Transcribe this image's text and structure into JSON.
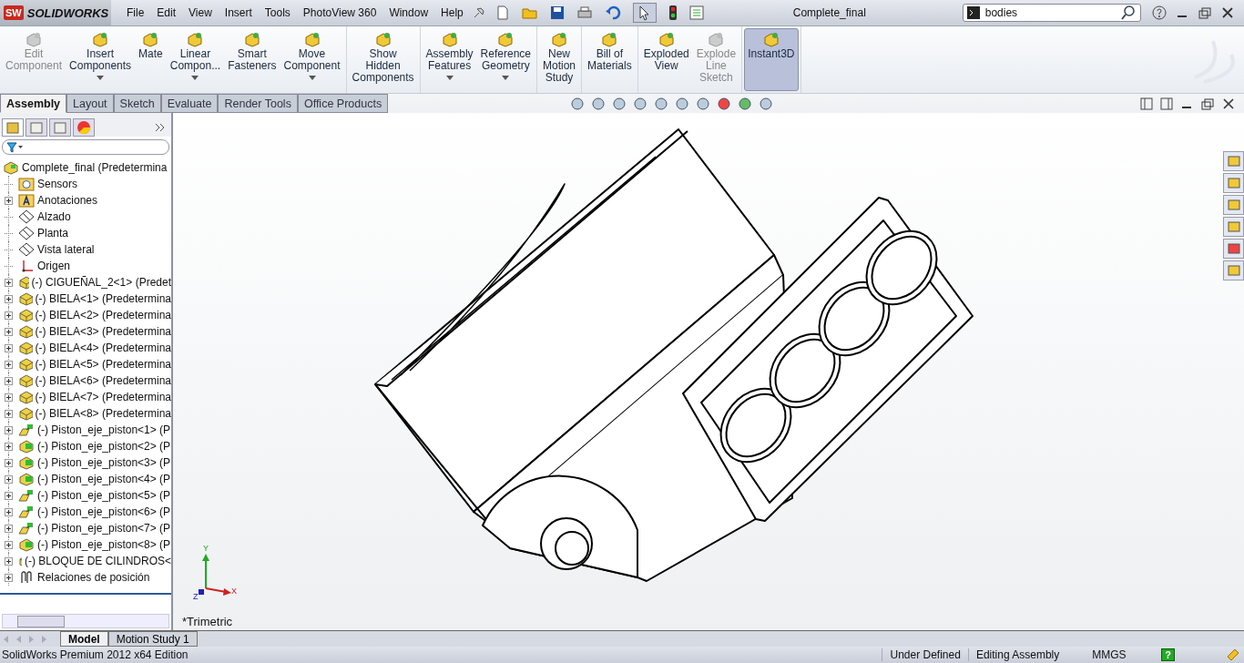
{
  "logo": {
    "badge": "SW",
    "name": "SOLIDWORKS"
  },
  "menu": [
    "File",
    "Edit",
    "View",
    "Insert",
    "Tools",
    "PhotoView 360",
    "Window",
    "Help"
  ],
  "document_title": "Complete_final",
  "search": {
    "value": "bodies"
  },
  "command_groups": [
    [
      {
        "label": "Edit\nComponent",
        "disabled": true,
        "dropdown": false,
        "selected": false
      },
      {
        "label": "Insert\nComponents",
        "disabled": false,
        "dropdown": true,
        "selected": false
      },
      {
        "label": "Mate",
        "disabled": false,
        "dropdown": false,
        "selected": false
      },
      {
        "label": "Linear\nCompon...",
        "disabled": false,
        "dropdown": true,
        "selected": false
      },
      {
        "label": "Smart\nFasteners",
        "disabled": false,
        "dropdown": false,
        "selected": false
      },
      {
        "label": "Move\nComponent",
        "disabled": false,
        "dropdown": true,
        "selected": false
      }
    ],
    [
      {
        "label": "Show\nHidden\nComponents",
        "disabled": false,
        "dropdown": false,
        "selected": false
      }
    ],
    [
      {
        "label": "Assembly\nFeatures",
        "disabled": false,
        "dropdown": true,
        "selected": false
      },
      {
        "label": "Reference\nGeometry",
        "disabled": false,
        "dropdown": true,
        "selected": false
      }
    ],
    [
      {
        "label": "New\nMotion\nStudy",
        "disabled": false,
        "dropdown": false,
        "selected": false
      }
    ],
    [
      {
        "label": "Bill of\nMaterials",
        "disabled": false,
        "dropdown": false,
        "selected": false
      }
    ],
    [
      {
        "label": "Exploded\nView",
        "disabled": false,
        "dropdown": false,
        "selected": false
      },
      {
        "label": "Explode\nLine\nSketch",
        "disabled": true,
        "dropdown": false,
        "selected": false
      }
    ],
    [
      {
        "label": "Instant3D",
        "disabled": false,
        "dropdown": false,
        "selected": true
      }
    ]
  ],
  "tabs": [
    {
      "label": "Assembly",
      "selected": true
    },
    {
      "label": "Layout",
      "selected": false
    },
    {
      "label": "Sketch",
      "selected": false
    },
    {
      "label": "Evaluate",
      "selected": false
    },
    {
      "label": "Render Tools",
      "selected": false
    },
    {
      "label": "Office Products",
      "selected": false
    }
  ],
  "panel_tabs": [
    {
      "selected": true
    },
    {
      "selected": false
    },
    {
      "selected": false
    },
    {
      "selected": false
    }
  ],
  "tree": {
    "label": "Complete_final  (Predetermina",
    "kind": "assembly",
    "children": [
      {
        "label": "Sensors",
        "kind": "sensor",
        "expandable": false
      },
      {
        "label": "Anotaciones",
        "kind": "annotation",
        "expandable": true
      },
      {
        "label": "Alzado",
        "kind": "plane",
        "expandable": false
      },
      {
        "label": "Planta",
        "kind": "plane",
        "expandable": false
      },
      {
        "label": "Vista lateral",
        "kind": "plane",
        "expandable": false
      },
      {
        "label": "Origen",
        "kind": "origin",
        "expandable": false
      },
      {
        "label": "(-) CIGUEÑAL_2<1> (Predet",
        "kind": "part",
        "expandable": true
      },
      {
        "label": "(-) BIELA<1> (Predetermina",
        "kind": "part",
        "expandable": true
      },
      {
        "label": "(-) BIELA<2> (Predetermina",
        "kind": "part",
        "expandable": true
      },
      {
        "label": "(-) BIELA<3> (Predetermina",
        "kind": "part",
        "expandable": true
      },
      {
        "label": "(-) BIELA<4> (Predetermina",
        "kind": "part",
        "expandable": true
      },
      {
        "label": "(-) BIELA<5> (Predetermina",
        "kind": "part",
        "expandable": true
      },
      {
        "label": "(-) BIELA<6> (Predetermina",
        "kind": "part",
        "expandable": true
      },
      {
        "label": "(-) BIELA<7> (Predetermina",
        "kind": "part",
        "expandable": true
      },
      {
        "label": "(-) BIELA<8> (Predetermina",
        "kind": "part",
        "expandable": true
      },
      {
        "label": "(-) Piston_eje_piston<1> (P",
        "kind": "flexible",
        "expandable": true
      },
      {
        "label": "(-) Piston_eje_piston<2> (P",
        "kind": "subassembly",
        "expandable": true
      },
      {
        "label": "(-) Piston_eje_piston<3> (P",
        "kind": "subassembly",
        "expandable": true
      },
      {
        "label": "(-) Piston_eje_piston<4> (P",
        "kind": "subassembly",
        "expandable": true
      },
      {
        "label": "(-) Piston_eje_piston<5> (P",
        "kind": "flexible",
        "expandable": true
      },
      {
        "label": "(-) Piston_eje_piston<6> (P",
        "kind": "flexible",
        "expandable": true
      },
      {
        "label": "(-) Piston_eje_piston<7> (P",
        "kind": "flexible",
        "expandable": true
      },
      {
        "label": "(-) Piston_eje_piston<8> (P",
        "kind": "subassembly",
        "expandable": true
      },
      {
        "label": "(-) BLOQUE DE CILINDROS<",
        "kind": "part",
        "expandable": true
      },
      {
        "label": "Relaciones de posición",
        "kind": "mates",
        "expandable": true
      }
    ]
  },
  "triad": {
    "x": "X",
    "y": "Y",
    "z": "Z"
  },
  "view_name": "*Trimetric",
  "bottom_tabs": [
    {
      "label": "Model",
      "selected": true
    },
    {
      "label": "Motion Study 1",
      "selected": false
    }
  ],
  "status_bar": {
    "edition": "SolidWorks Premium 2012 x64 Edition",
    "state": "Under Defined",
    "mode": "Editing Assembly",
    "units": "MMGS",
    "help": "?"
  }
}
